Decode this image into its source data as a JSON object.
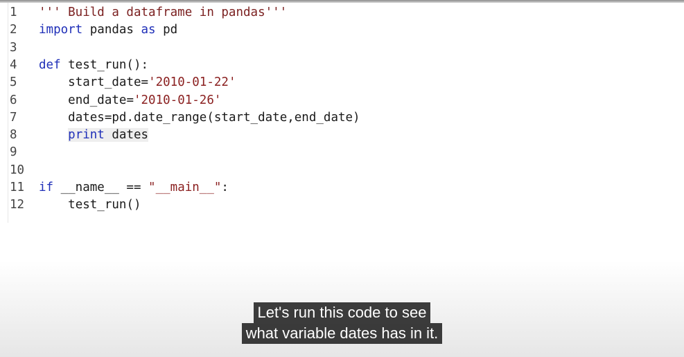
{
  "editor": {
    "lines": [
      {
        "num": "1",
        "indent": "",
        "tokens": [
          {
            "t": "''' Build a dataframe in pandas'''",
            "c": "doc"
          }
        ]
      },
      {
        "num": "2",
        "indent": "",
        "tokens": [
          {
            "t": "import",
            "c": "kw"
          },
          {
            "t": " pandas ",
            "c": "plain"
          },
          {
            "t": "as",
            "c": "kw"
          },
          {
            "t": " pd",
            "c": "plain"
          }
        ]
      },
      {
        "num": "3",
        "indent": "",
        "tokens": []
      },
      {
        "num": "4",
        "indent": "",
        "tokens": [
          {
            "t": "def",
            "c": "kw"
          },
          {
            "t": " test_run():",
            "c": "plain"
          }
        ]
      },
      {
        "num": "5",
        "indent": "    ",
        "tokens": [
          {
            "t": "start_date=",
            "c": "plain"
          },
          {
            "t": "'2010-01-22'",
            "c": "str"
          }
        ]
      },
      {
        "num": "6",
        "indent": "    ",
        "tokens": [
          {
            "t": "end_date=",
            "c": "plain"
          },
          {
            "t": "'2010-01-26'",
            "c": "str"
          }
        ]
      },
      {
        "num": "7",
        "indent": "    ",
        "tokens": [
          {
            "t": "dates=pd.date_range(start_date,end_date)",
            "c": "plain"
          }
        ]
      },
      {
        "num": "8",
        "indent": "    ",
        "tokens": [
          {
            "t": "print",
            "c": "kw",
            "hl": true
          },
          {
            "t": " dates",
            "c": "plain",
            "hl": true
          }
        ]
      },
      {
        "num": "9",
        "indent": "",
        "tokens": []
      },
      {
        "num": "10",
        "indent": "",
        "tokens": []
      },
      {
        "num": "11",
        "indent": "",
        "tokens": [
          {
            "t": "if",
            "c": "kw"
          },
          {
            "t": " __name__ == ",
            "c": "plain"
          },
          {
            "t": "\"__main__\"",
            "c": "str"
          },
          {
            "t": ":",
            "c": "plain"
          }
        ]
      },
      {
        "num": "12",
        "indent": "    ",
        "tokens": [
          {
            "t": "test_run()",
            "c": "plain"
          }
        ]
      }
    ]
  },
  "captions": {
    "line1": "Let's run this code to see",
    "line2": "what variable dates has in it."
  },
  "colors": {
    "keyword": "#1f2fb8",
    "string": "#8a1f1f",
    "docstring": "#7a1f1f",
    "text": "#1a1a1a",
    "caption_bg": "#141414"
  }
}
